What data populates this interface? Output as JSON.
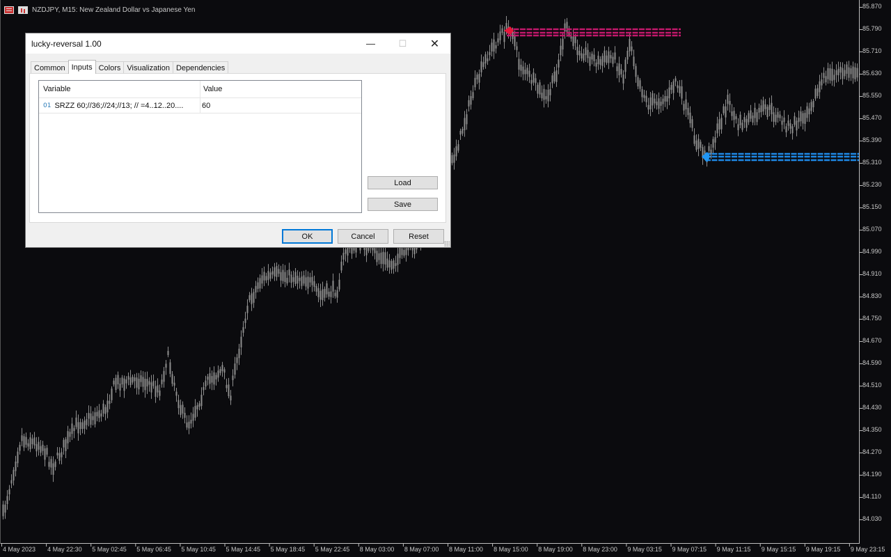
{
  "chart": {
    "symbol_title": "NZDJPY, M15:  New Zealand Dollar vs Japanese Yen",
    "price_labels": [
      "85.870",
      "85.790",
      "85.710",
      "85.630",
      "85.550",
      "85.470",
      "85.390",
      "85.310",
      "85.230",
      "85.150",
      "85.070",
      "84.990",
      "84.910",
      "84.830",
      "84.750",
      "84.670",
      "84.590",
      "84.510",
      "84.430",
      "84.350",
      "84.270",
      "84.190",
      "84.110",
      "84.030"
    ],
    "time_labels": [
      "4 May 2023",
      "4 May 22:30",
      "5 May 02:45",
      "5 May 06:45",
      "5 May 10:45",
      "5 May 14:45",
      "5 May 18:45",
      "5 May 22:45",
      "8 May 03:00",
      "8 May 07:00",
      "8 May 11:00",
      "8 May 15:00",
      "8 May 19:00",
      "8 May 23:00",
      "9 May 03:15",
      "9 May 07:15",
      "9 May 11:15",
      "9 May 15:15",
      "9 May 19:15",
      "9 May 23:15"
    ],
    "colors": {
      "background": "#0b0b0e",
      "candle": "#8f8f8f",
      "resistance": "#c2186b",
      "support": "#1e88e5"
    }
  },
  "dialog": {
    "title": "lucky-reversal 1.00",
    "window_buttons": {
      "minimize": "—",
      "maximize": "☐",
      "close": "✕"
    },
    "tabs": [
      "Common",
      "Inputs",
      "Colors",
      "Visualization",
      "Dependencies"
    ],
    "active_tab": "Inputs",
    "table": {
      "headers": {
        "variable": "Variable",
        "value": "Value"
      },
      "rows": [
        {
          "icon": "01",
          "variable": "SRZZ  60;//36;//24;//13; // =4..12..20....",
          "value": "60"
        }
      ]
    },
    "side_buttons": {
      "load": "Load",
      "save": "Save"
    },
    "buttons": {
      "ok": "OK",
      "cancel": "Cancel",
      "reset": "Reset"
    }
  }
}
